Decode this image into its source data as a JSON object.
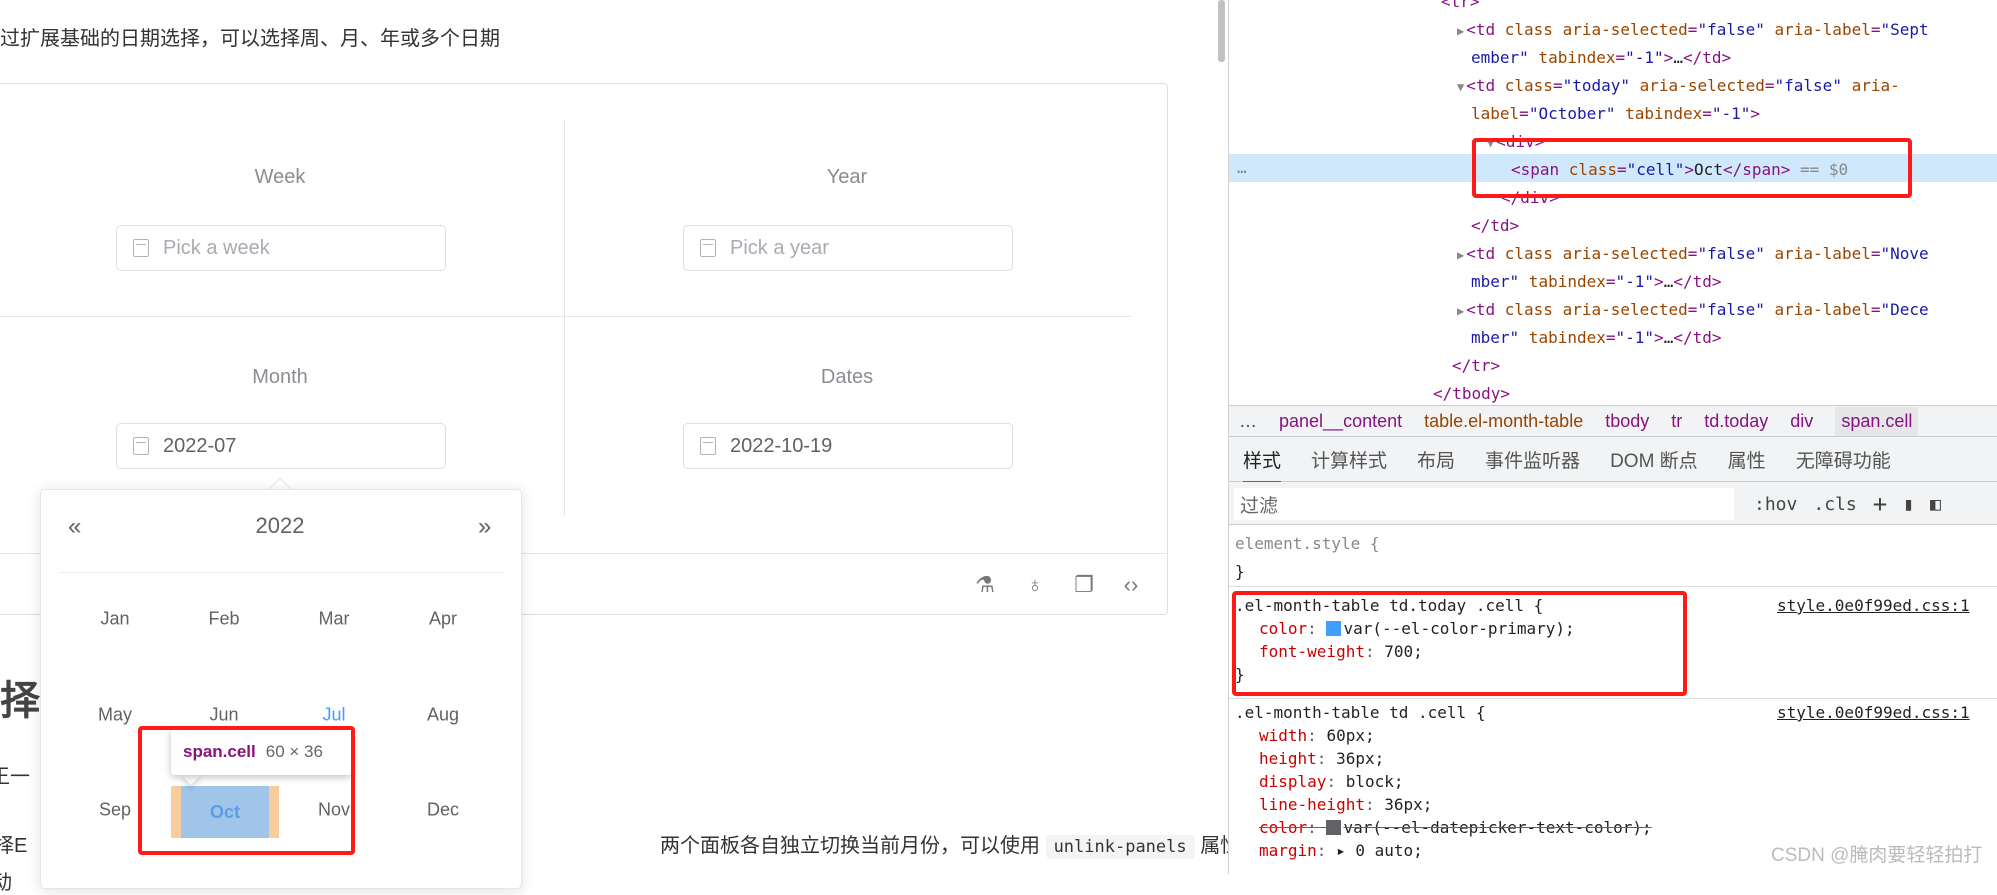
{
  "page": {
    "intro": "过扩展基础的日期选择，可以选择周、月、年或多个日期",
    "heading_fragment": "择",
    "text_fragment_1": "王一",
    "text_fragment_2": "择E",
    "text_fragment_3": "动",
    "text_line": "两个面板各自独立切换当前月份，可以使用",
    "code": "unlink-panels",
    "text_after_code": "属性解"
  },
  "demo": {
    "week": {
      "label": "Week",
      "placeholder": "Pick a week",
      "value": ""
    },
    "year": {
      "label": "Year",
      "placeholder": "Pick a year",
      "value": ""
    },
    "month": {
      "label": "Month",
      "placeholder": "",
      "value": "2022-07"
    },
    "dates": {
      "label": "Dates",
      "placeholder": "",
      "value": "2022-10-19"
    },
    "footer_icons": [
      "flask-icon",
      "github-icon",
      "copy-icon",
      "code-icon"
    ]
  },
  "month_picker": {
    "year": "2022",
    "prev": "«",
    "next": "»",
    "months": [
      "Jan",
      "Feb",
      "Mar",
      "Apr",
      "May",
      "Jun",
      "Jul",
      "Aug",
      "Sep",
      "Oct",
      "Nov",
      "Dec"
    ],
    "selected": "Jul",
    "today": "Oct",
    "primary_color": "#409eff"
  },
  "inspect_tooltip": {
    "selector": "span.cell",
    "size": "60 × 36"
  },
  "devtools": {
    "dom_lines": [
      [
        [
          "tag",
          "<tr>"
        ]
      ],
      [
        [
          "tag",
          "<td "
        ],
        [
          "attr",
          "class aria-selected"
        ],
        [
          "tag",
          "="
        ],
        [
          "av",
          "\"false\""
        ],
        [
          "attr",
          " aria-label"
        ],
        [
          "tag",
          "="
        ],
        [
          "av",
          "\"Sept"
        ]
      ],
      [
        [
          "av",
          "ember\""
        ],
        [
          "attr",
          " tabindex"
        ],
        [
          "tag",
          "="
        ],
        [
          "av",
          "\"-1\""
        ],
        [
          "tag",
          ">"
        ],
        [
          "tx",
          "…"
        ],
        [
          "tag",
          "</td>"
        ]
      ],
      [
        [
          "tag",
          "<td "
        ],
        [
          "attr",
          "class"
        ],
        [
          "tag",
          "="
        ],
        [
          "av",
          "\"today\""
        ],
        [
          "attr",
          " aria-selected"
        ],
        [
          "tag",
          "="
        ],
        [
          "av",
          "\"false\""
        ],
        [
          "attr",
          " aria-"
        ]
      ],
      [
        [
          "attr",
          "label"
        ],
        [
          "tag",
          "="
        ],
        [
          "av",
          "\"October\""
        ],
        [
          "attr",
          " tabindex"
        ],
        [
          "tag",
          "="
        ],
        [
          "av",
          "\"-1\""
        ],
        [
          "tag",
          ">"
        ]
      ],
      [
        [
          "tag",
          "<div>"
        ]
      ],
      [
        [
          "tag",
          "<span "
        ],
        [
          "attr",
          "class"
        ],
        [
          "tag",
          "="
        ],
        [
          "av",
          "\"cell\""
        ],
        [
          "tag",
          ">"
        ],
        [
          "tx",
          "Oct"
        ],
        [
          "tag",
          "</span>"
        ],
        [
          "cm",
          " == $0"
        ]
      ],
      [
        [
          "tag",
          "</div>"
        ]
      ],
      [
        [
          "tag",
          "</td>"
        ]
      ],
      [
        [
          "tag",
          "<td "
        ],
        [
          "attr",
          "class aria-selected"
        ],
        [
          "tag",
          "="
        ],
        [
          "av",
          "\"false\""
        ],
        [
          "attr",
          " aria-label"
        ],
        [
          "tag",
          "="
        ],
        [
          "av",
          "\"Nove"
        ]
      ],
      [
        [
          "av",
          "mber\""
        ],
        [
          "attr",
          " tabindex"
        ],
        [
          "tag",
          "="
        ],
        [
          "av",
          "\"-1\""
        ],
        [
          "tag",
          ">"
        ],
        [
          "tx",
          "…"
        ],
        [
          "tag",
          "</td>"
        ]
      ],
      [
        [
          "tag",
          "<td "
        ],
        [
          "attr",
          "class aria-selected"
        ],
        [
          "tag",
          "="
        ],
        [
          "av",
          "\"false\""
        ],
        [
          "attr",
          " aria-label"
        ],
        [
          "tag",
          "="
        ],
        [
          "av",
          "\"Dece"
        ]
      ],
      [
        [
          "av",
          "mber\""
        ],
        [
          "attr",
          " tabindex"
        ],
        [
          "tag",
          "="
        ],
        [
          "av",
          "\"-1\""
        ],
        [
          "tag",
          ">"
        ],
        [
          "tx",
          "…"
        ],
        [
          "tag",
          "</td>"
        ]
      ],
      [
        [
          "tag",
          "</tr>"
        ]
      ],
      [
        [
          "tag",
          "</tbody>"
        ]
      ]
    ],
    "row_ellipsis": "…",
    "breadcrumbs": [
      "…",
      "panel__content",
      "table.el-month-table",
      "tbody",
      "tr",
      "td.today",
      "div",
      "span.cell"
    ],
    "tabs": [
      "样式",
      "计算样式",
      "布局",
      "事件监听器",
      "DOM 断点",
      "属性",
      "无障碍功能"
    ],
    "active_tab": "样式",
    "filter_placeholder": "过滤",
    "hov": ":hov",
    "cls": ".cls",
    "plus": "+",
    "element_style": "element.style {",
    "close_brace": "}",
    "rule1": {
      "selector": ".el-month-table td.today .cell {",
      "source": "style.0e0f99ed.css:1",
      "props": [
        [
          "color",
          "var(--el-color-primary);"
        ],
        [
          "font-weight",
          "700;"
        ]
      ]
    },
    "rule2": {
      "selector": ".el-month-table td .cell {",
      "source": "style.0e0f99ed.css:1",
      "props": [
        [
          "width",
          "60px;"
        ],
        [
          "height",
          "36px;"
        ],
        [
          "display",
          "block;"
        ],
        [
          "line-height",
          "36px;"
        ],
        [
          "color",
          "var(--el-datepicker-text-color);"
        ],
        [
          "margin",
          "▸ 0 auto;"
        ]
      ]
    },
    "swatch_primary": "#409eff",
    "swatch_text": "#606266"
  },
  "watermark": "CSDN @腌肉要轻轻拍打"
}
